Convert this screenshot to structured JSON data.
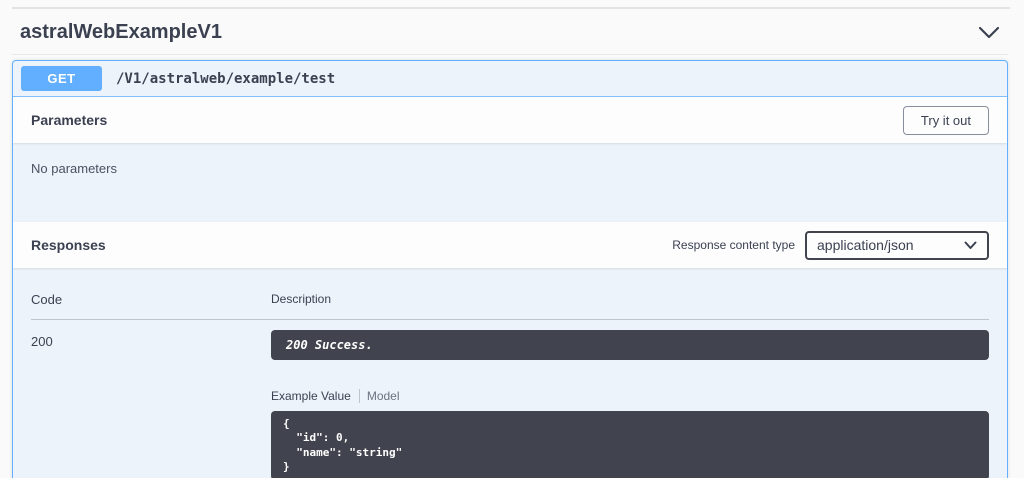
{
  "section": {
    "title": "astralWebExampleV1"
  },
  "operation": {
    "method": "GET",
    "path": "/V1/astralweb/example/test"
  },
  "parameters": {
    "title": "Parameters",
    "try_it_out_label": "Try it out",
    "empty_message": "No parameters"
  },
  "responses": {
    "title": "Responses",
    "content_type_label": "Response content type",
    "content_type_value": "application/json",
    "table": {
      "headers": [
        "Code",
        "Description"
      ],
      "rows": [
        {
          "code": "200",
          "description": "200 Success.",
          "tabs": [
            "Example Value",
            "Model"
          ],
          "active_tab": "Example Value",
          "example": "{\n  \"id\": 0,\n  \"name\": \"string\"\n}"
        }
      ]
    }
  },
  "colors": {
    "method_badge": "#61affe",
    "opblock_border": "#61affe",
    "opblock_background": "#ecf3fb",
    "dark_code_block": "#41444e",
    "heading_text": "#3b4151"
  }
}
